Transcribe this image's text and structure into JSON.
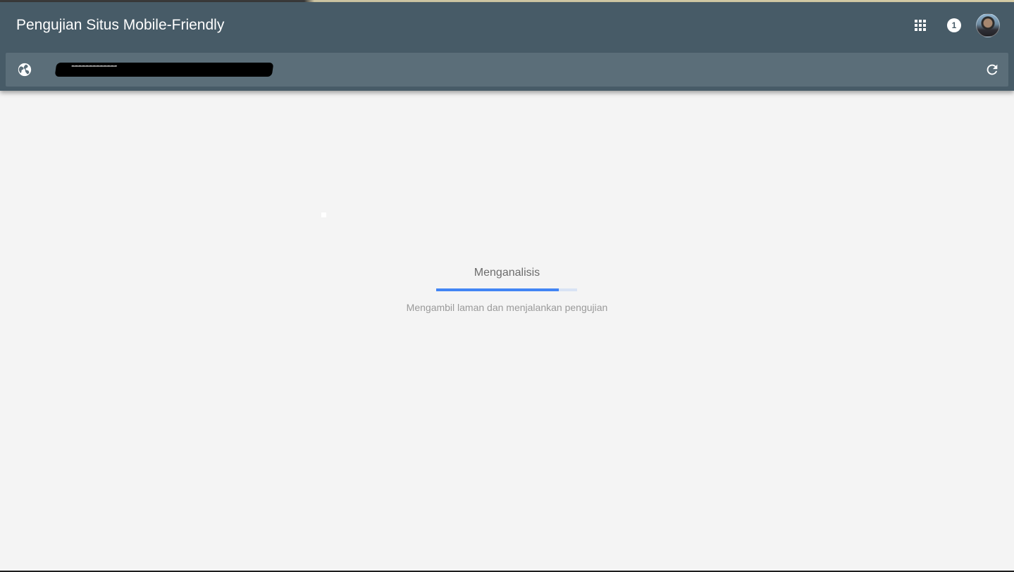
{
  "app": {
    "title": "Pengujian Situs Mobile-Friendly"
  },
  "header": {
    "icons": [
      "apps-grid-icon",
      "notification-icon",
      "avatar"
    ],
    "notification_count": "1"
  },
  "url_bar": {
    "value": "",
    "placeholder": "",
    "redacted": true,
    "leading_icon": "globe-icon",
    "trailing_icon": "refresh-icon"
  },
  "analysis": {
    "status_title": "Menganalisis",
    "status_detail": "Mengambil laman dan menjalankan pengujian",
    "progress_fraction": 0.87
  },
  "colors": {
    "header_bg": "#475b67",
    "url_bar_bg": "#5b6e79",
    "page_bg": "#f4f4f4",
    "progress_fill": "#4285f4",
    "progress_track": "#d8e3f4"
  }
}
